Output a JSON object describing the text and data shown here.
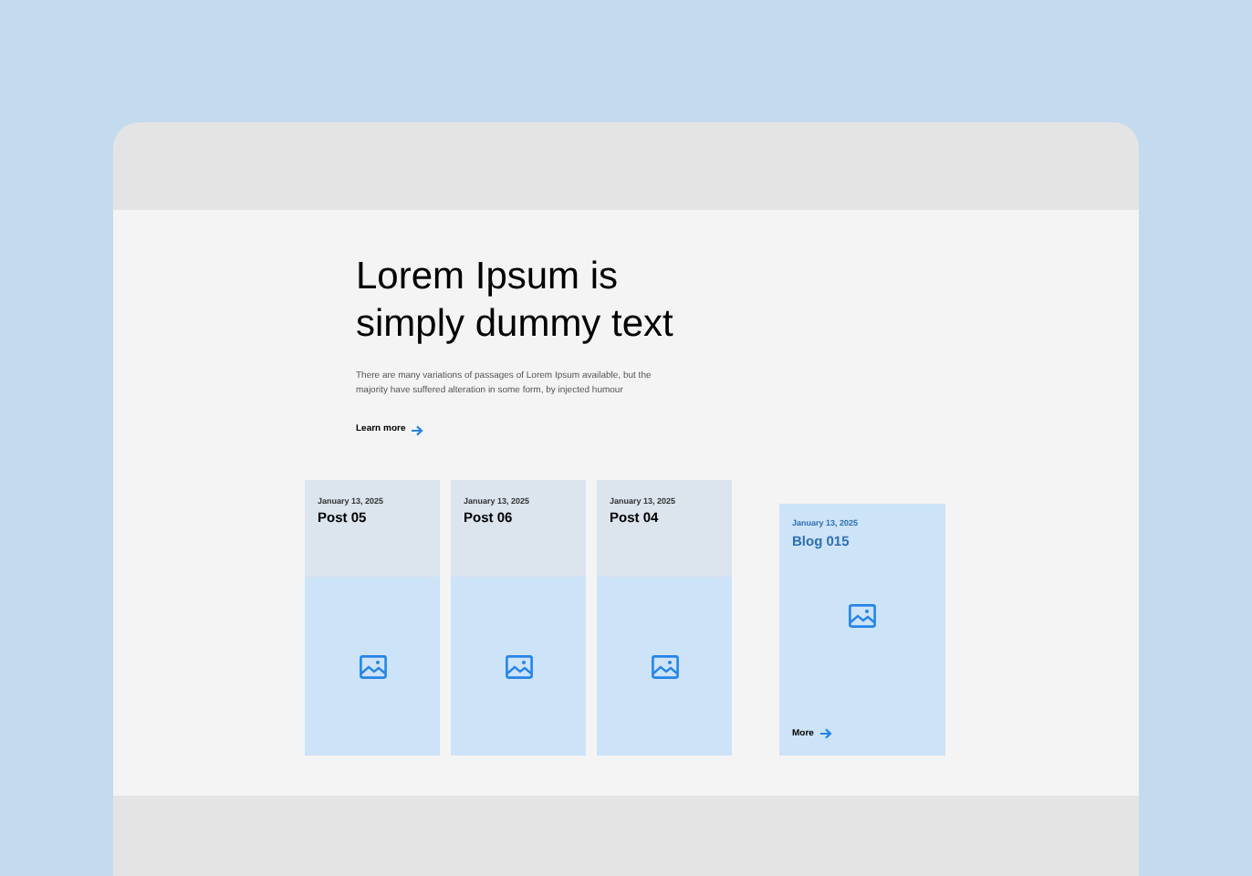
{
  "hero": {
    "title": "Lorem Ipsum is simply dummy text",
    "description": "There are many variations of passages of Lorem Ipsum available, but the majority have suffered alteration in some form, by injected humour",
    "link": "Learn more"
  },
  "posts": [
    {
      "date": "January 13, 2025",
      "title": "Post 05"
    },
    {
      "date": "January 13, 2025",
      "title": "Post 06"
    },
    {
      "date": "January 13, 2025",
      "title": "Post 04"
    }
  ],
  "featured": {
    "date": "January 13, 2025",
    "title": "Blog 015",
    "link": "More"
  }
}
